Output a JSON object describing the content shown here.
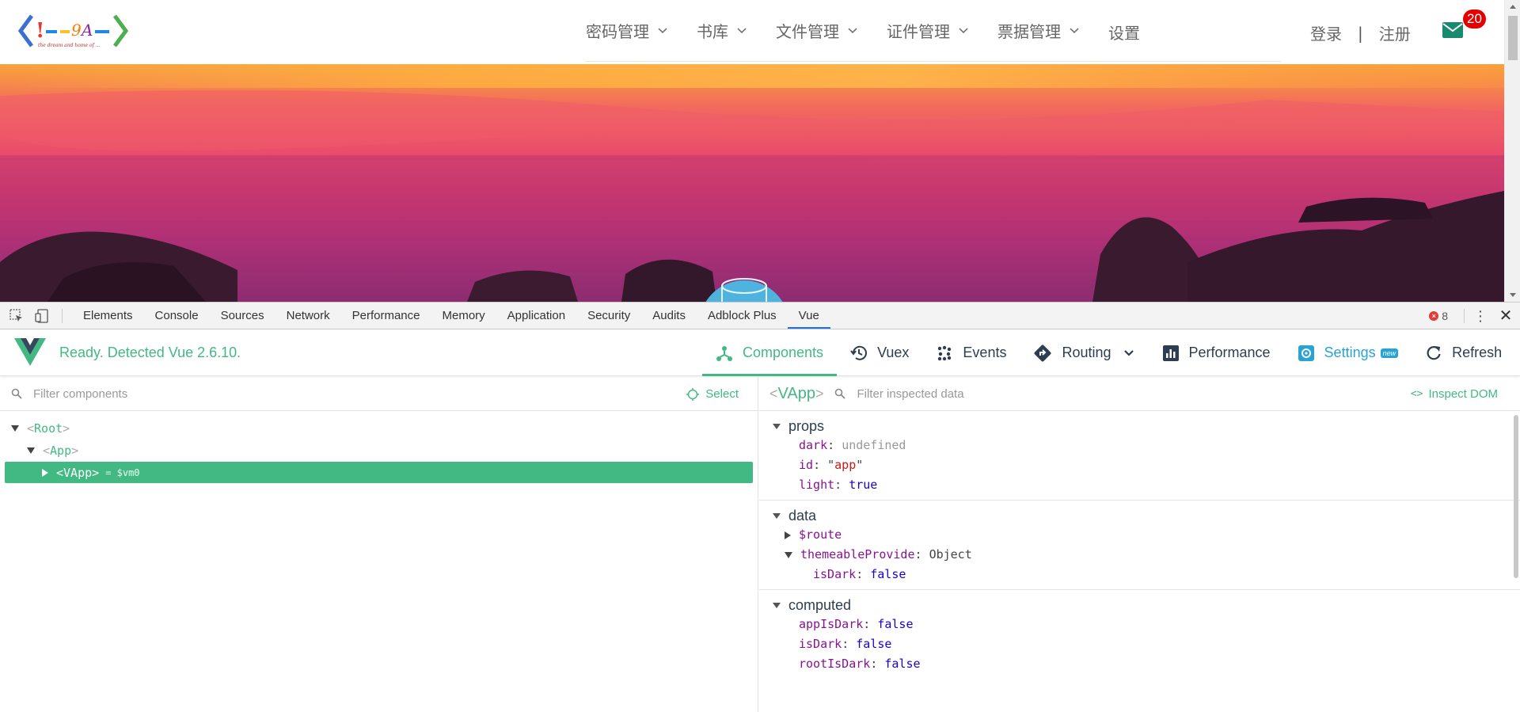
{
  "site": {
    "logo_text": "<!--9A-->",
    "logo_tagline": "the dream and home of ...",
    "nav": [
      {
        "label": "密码管理",
        "has_dropdown": true
      },
      {
        "label": "书库",
        "has_dropdown": true
      },
      {
        "label": "文件管理",
        "has_dropdown": true
      },
      {
        "label": "证件管理",
        "has_dropdown": true
      },
      {
        "label": "票据管理",
        "has_dropdown": true
      },
      {
        "label": "设置",
        "has_dropdown": false
      }
    ],
    "login": "登录",
    "separator": "|",
    "register": "注册",
    "mail_count": "20",
    "colors": {
      "mail_icon": "#1a8a6e",
      "badge": "#e40000"
    }
  },
  "devtools": {
    "tabs": [
      "Elements",
      "Console",
      "Sources",
      "Network",
      "Performance",
      "Memory",
      "Application",
      "Security",
      "Audits",
      "Adblock Plus",
      "Vue"
    ],
    "active_tab": "Vue",
    "error_count": "8",
    "icons": [
      "inspect-element-icon",
      "device-toggle-icon",
      "kebab-menu-icon",
      "close-icon"
    ]
  },
  "vue": {
    "status": "Ready. Detected Vue 2.6.10.",
    "nav": {
      "components": "Components",
      "vuex": "Vuex",
      "events": "Events",
      "routing": "Routing",
      "performance": "Performance",
      "settings": "Settings",
      "settings_badge": "new",
      "refresh": "Refresh"
    },
    "filter_placeholder": "Filter components",
    "select_label": "Select",
    "tree": {
      "root": "Root",
      "app": "App",
      "vapp": "VApp",
      "vm": "= $vm0"
    },
    "inspector": {
      "title": "VApp",
      "filter_placeholder": "Filter inspected data",
      "inspect_dom": "Inspect DOM",
      "props_title": "props",
      "props": [
        {
          "key": "dark",
          "value": "undefined"
        },
        {
          "key": "id",
          "value": "app"
        },
        {
          "key": "light",
          "value": "true"
        }
      ],
      "data_title": "data",
      "data": {
        "route_key": "$route",
        "themeable_key": "themeableProvide",
        "themeable_value": "Object",
        "isdark_key": "isDark",
        "isdark_value": "false"
      },
      "computed_title": "computed",
      "computed": [
        {
          "key": "appIsDark",
          "value": "false"
        },
        {
          "key": "isDark",
          "value": "false"
        },
        {
          "key": "rootIsDark",
          "value": "false"
        }
      ]
    },
    "colors": {
      "accent": "#42b983",
      "settings": "#2aa2d6",
      "text": "#2c3e50"
    }
  }
}
